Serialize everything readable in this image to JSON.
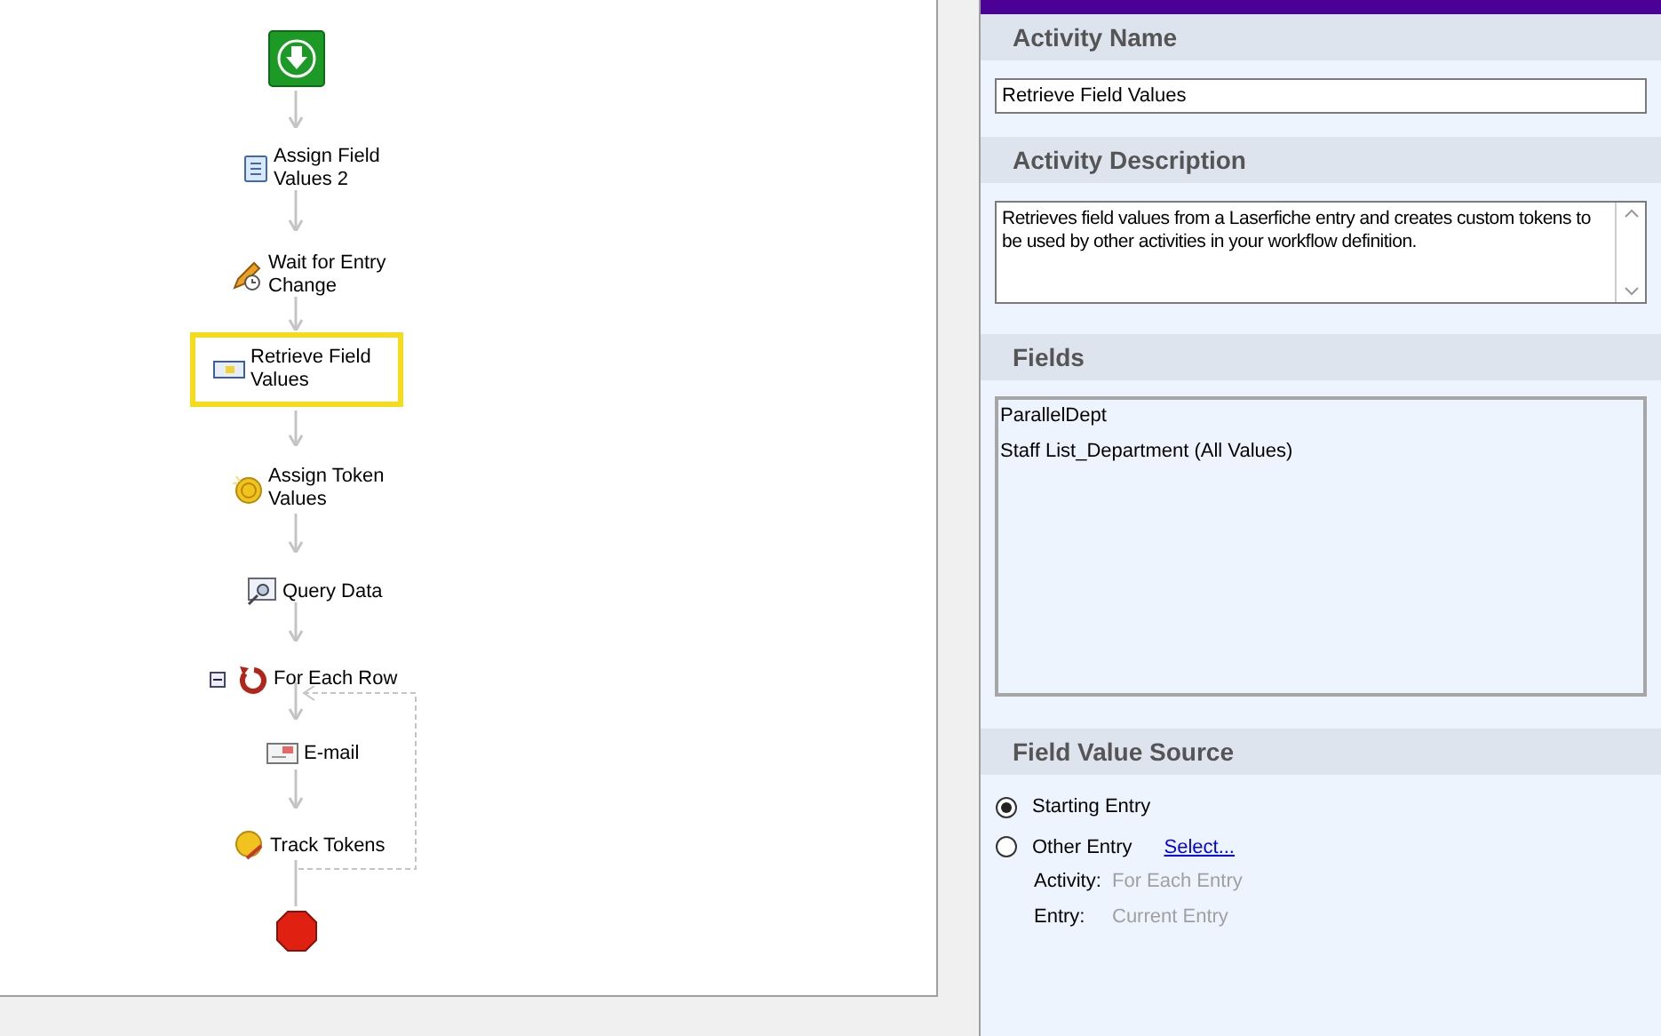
{
  "workflow": {
    "nodes": [
      {
        "kind": "assign-fields",
        "lines": [
          "Assign Field",
          "Values 2"
        ],
        "selected": false
      },
      {
        "kind": "wait",
        "lines": [
          "Wait for Entry",
          "Change"
        ],
        "selected": false
      },
      {
        "kind": "retrieve",
        "lines": [
          "Retrieve Field",
          "Values"
        ],
        "selected": true
      },
      {
        "kind": "token",
        "lines": [
          "Assign Token",
          "Values"
        ],
        "selected": false
      },
      {
        "kind": "query",
        "lines": [
          "Query Data"
        ],
        "selected": false
      },
      {
        "kind": "loop",
        "lines": [
          "For Each Row"
        ],
        "selected": false,
        "expanded": true
      },
      {
        "kind": "email",
        "lines": [
          "E-mail"
        ],
        "selected": false
      },
      {
        "kind": "track",
        "lines": [
          "Track Tokens"
        ],
        "selected": false
      }
    ]
  },
  "properties": {
    "activity_name": {
      "heading": "Activity Name",
      "value": "Retrieve Field Values"
    },
    "activity_description": {
      "heading": "Activity Description",
      "value": "Retrieves field values from a Laserfiche entry and creates custom tokens to be used by other activities in your workflow definition."
    },
    "fields": {
      "heading": "Fields",
      "items": [
        "ParallelDept",
        "Staff List_Department (All Values)"
      ]
    },
    "field_value_source": {
      "heading": "Field Value Source",
      "options": [
        {
          "label": "Starting Entry",
          "selected": true
        },
        {
          "label": "Other Entry",
          "selected": false,
          "link": "Select..."
        }
      ],
      "details": [
        {
          "label": "Activity:",
          "value": "For Each Entry"
        },
        {
          "label": "Entry:",
          "value": "Current Entry"
        }
      ]
    }
  }
}
